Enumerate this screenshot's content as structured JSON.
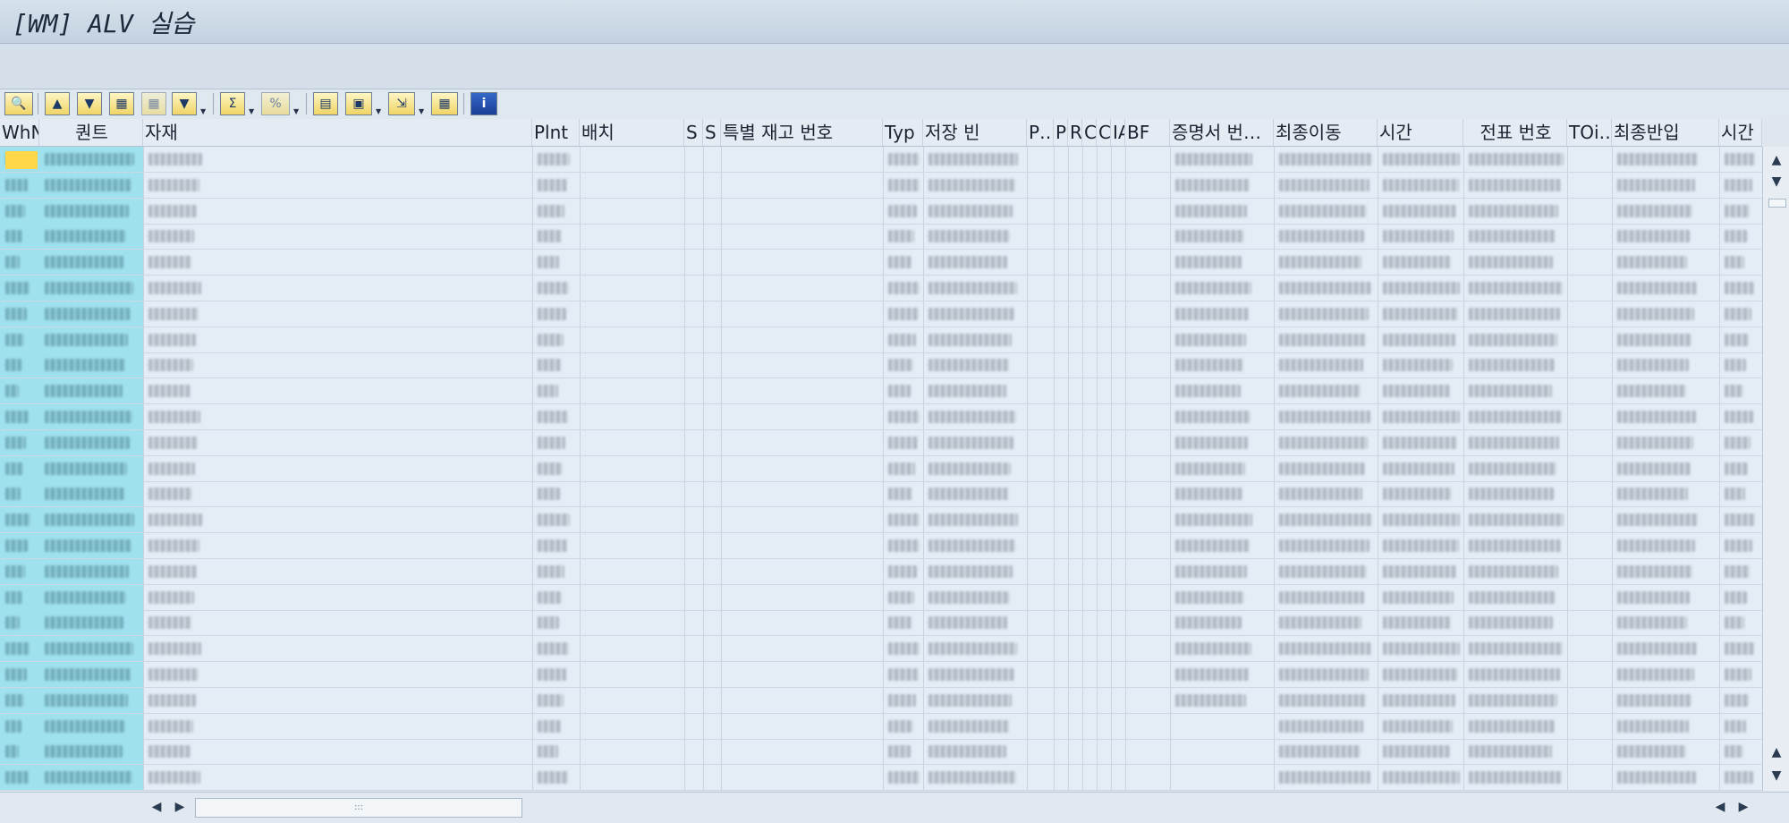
{
  "window": {
    "title": "[WM] ALV 실습"
  },
  "toolbar": {
    "buttons": [
      {
        "name": "detail-icon",
        "glyph": "🔍"
      },
      {
        "name": "sort-ascending-icon",
        "glyph": "▲"
      },
      {
        "name": "sort-descending-icon",
        "glyph": "▼"
      },
      {
        "name": "find-icon",
        "glyph": "▦"
      },
      {
        "name": "find-next-icon",
        "glyph": "▦"
      },
      {
        "name": "filter-icon",
        "glyph": "▼"
      },
      {
        "name": "sum-icon",
        "glyph": "Σ"
      },
      {
        "name": "subtotal-icon",
        "glyph": "%"
      },
      {
        "name": "print-icon",
        "glyph": "▤"
      },
      {
        "name": "views-icon",
        "glyph": "▣"
      },
      {
        "name": "export-icon",
        "glyph": "⇲"
      },
      {
        "name": "layout-icon",
        "glyph": "▦"
      },
      {
        "name": "information-icon",
        "glyph": "i"
      }
    ]
  },
  "table": {
    "columns": [
      "WhN",
      "퀀트",
      "자재",
      "Plnt",
      "배치",
      "S",
      "S",
      "특별 재고 번호",
      "Typ",
      "저장 빈",
      "P…",
      "PE",
      "RE",
      "CF",
      "CF",
      "IA",
      "BF",
      "증명서 번…",
      "최종이동",
      "시간",
      "전표 번호",
      "TOi…",
      "최종반입",
      "시간"
    ],
    "row_count": 25
  },
  "scrollbars": {
    "up": "▲",
    "down": "▼",
    "left": "◀",
    "right": "▶",
    "grip": ":::"
  }
}
